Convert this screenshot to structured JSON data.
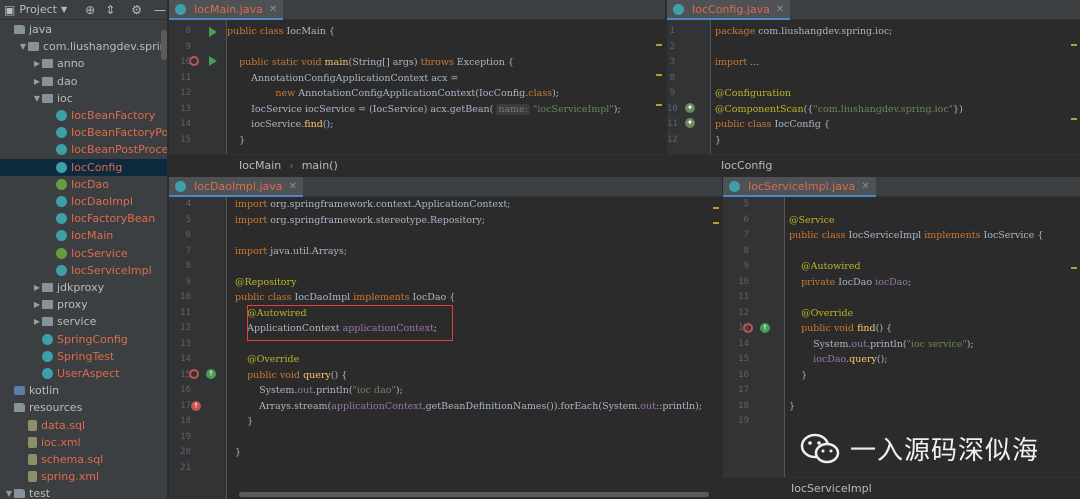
{
  "project_panel": {
    "title": "Project",
    "tree": [
      {
        "label": "java",
        "depth": 0,
        "arrow": "",
        "icon": "folder",
        "color": "normal"
      },
      {
        "label": "com.liushangdev.spring",
        "depth": 1,
        "arrow": "down",
        "icon": "pkg",
        "color": "normal"
      },
      {
        "label": "anno",
        "depth": 2,
        "arrow": "right",
        "icon": "pkg",
        "color": "normal"
      },
      {
        "label": "dao",
        "depth": 2,
        "arrow": "right",
        "icon": "pkg",
        "color": "normal"
      },
      {
        "label": "ioc",
        "depth": 2,
        "arrow": "down",
        "icon": "pkg",
        "color": "normal"
      },
      {
        "label": "IocBeanFactory",
        "depth": 3,
        "arrow": "",
        "icon": "class",
        "color": "red"
      },
      {
        "label": "IocBeanFactoryPostPro",
        "depth": 3,
        "arrow": "",
        "icon": "class",
        "color": "red"
      },
      {
        "label": "IocBeanPostProcessor",
        "depth": 3,
        "arrow": "",
        "icon": "class",
        "color": "red"
      },
      {
        "label": "IocConfig",
        "depth": 3,
        "arrow": "",
        "icon": "class",
        "color": "red",
        "selected": true
      },
      {
        "label": "IocDao",
        "depth": 3,
        "arrow": "",
        "icon": "iface",
        "color": "red"
      },
      {
        "label": "IocDaoImpl",
        "depth": 3,
        "arrow": "",
        "icon": "class",
        "color": "red"
      },
      {
        "label": "IocFactoryBean",
        "depth": 3,
        "arrow": "",
        "icon": "class",
        "color": "red"
      },
      {
        "label": "IocMain",
        "depth": 3,
        "arrow": "",
        "icon": "class",
        "color": "red"
      },
      {
        "label": "IocService",
        "depth": 3,
        "arrow": "",
        "icon": "iface",
        "color": "red"
      },
      {
        "label": "IocServiceImpl",
        "depth": 3,
        "arrow": "",
        "icon": "class",
        "color": "red"
      },
      {
        "label": "jdkproxy",
        "depth": 2,
        "arrow": "right",
        "icon": "pkg",
        "color": "normal"
      },
      {
        "label": "proxy",
        "depth": 2,
        "arrow": "right",
        "icon": "pkg",
        "color": "normal"
      },
      {
        "label": "service",
        "depth": 2,
        "arrow": "right",
        "icon": "pkg",
        "color": "normal"
      },
      {
        "label": "SpringConfig",
        "depth": 2,
        "arrow": "",
        "icon": "class",
        "color": "red"
      },
      {
        "label": "SpringTest",
        "depth": 2,
        "arrow": "",
        "icon": "class",
        "color": "red"
      },
      {
        "label": "UserAspect",
        "depth": 2,
        "arrow": "",
        "icon": "class",
        "color": "red"
      },
      {
        "label": "kotlin",
        "depth": 0,
        "arrow": "",
        "icon": "srcroot",
        "color": "normal"
      },
      {
        "label": "resources",
        "depth": 0,
        "arrow": "",
        "icon": "folder",
        "color": "normal"
      },
      {
        "label": "data.sql",
        "depth": 1,
        "arrow": "",
        "icon": "file",
        "color": "red"
      },
      {
        "label": "ioc.xml",
        "depth": 1,
        "arrow": "",
        "icon": "file",
        "color": "red"
      },
      {
        "label": "schema.sql",
        "depth": 1,
        "arrow": "",
        "icon": "file",
        "color": "red"
      },
      {
        "label": "spring.xml",
        "depth": 1,
        "arrow": "",
        "icon": "file",
        "color": "red"
      },
      {
        "label": "test",
        "depth": 0,
        "arrow": "down",
        "icon": "folder",
        "color": "normal"
      }
    ]
  },
  "panes": {
    "ioc_main": {
      "tab": "IocMain.java",
      "breadcrumb": [
        "IocMain",
        "main()"
      ],
      "line_numbers": [
        "8",
        "9",
        "10",
        "11",
        "12",
        "13",
        "14",
        "15"
      ],
      "lines": [
        "public class IocMain {",
        "",
        "    public static void main(String[] args) throws Exception {",
        "        AnnotationConfigApplicationContext acx =",
        "                new AnnotationConfigApplicationContext(IocConfig.class);",
        "        IocService iocService = (IocService) acx.getBean( name: \"iocServiceImpl\");",
        "        iocService.find();",
        "    }"
      ]
    },
    "ioc_config": {
      "tab": "IocConfig.java",
      "breadcrumb": [
        "IocConfig"
      ],
      "line_numbers": [
        "1",
        "2",
        "3",
        "8",
        "9",
        "10",
        "11",
        "12"
      ],
      "lines": [
        "package com.liushangdev.spring.ioc;",
        "",
        "import ...",
        "",
        "@Configuration",
        "@ComponentScan({\"com.liushangdev.spring.ioc\"})",
        "public class IocConfig {",
        "}"
      ]
    },
    "ioc_dao_impl": {
      "tab": "IocDaoImpl.java",
      "line_numbers": [
        "4",
        "5",
        "6",
        "7",
        "8",
        "9",
        "10",
        "11",
        "12",
        "13",
        "14",
        "15",
        "16",
        "17",
        "18",
        "19",
        "20",
        "21"
      ],
      "lines": [
        "import org.springframework.context.ApplicationContext;",
        "import org.springframework.stereotype.Repository;",
        "",
        "import java.util.Arrays;",
        "",
        "@Repository",
        "public class IocDaoImpl implements IocDao {",
        "    @Autowired",
        "    ApplicationContext applicationContext;",
        "",
        "    @Override",
        "    public void query() {",
        "        System.out.println(\"ioc dao\");",
        "        Arrays.stream(applicationContext.getBeanDefinitionNames()).forEach(System.out::println);",
        "    }",
        "",
        "}",
        ""
      ]
    },
    "ioc_service_impl": {
      "tab": "IocServiceImpl.java",
      "breadcrumb": [
        "IocServiceImpl"
      ],
      "line_numbers": [
        "5",
        "6",
        "7",
        "8",
        "9",
        "10",
        "11",
        "12",
        "13",
        "14",
        "15",
        "16",
        "17",
        "18",
        "19"
      ],
      "lines": [
        "",
        "@Service",
        "public class IocServiceImpl implements IocService {",
        "",
        "    @Autowired",
        "    private IocDao iocDao;",
        "",
        "    @Override",
        "    public void find() {",
        "        System.out.println(\"ioc service\");",
        "        iocDao.query();",
        "    }",
        "",
        "}",
        ""
      ]
    }
  },
  "watermark": {
    "text": "一入源码深似海"
  },
  "colors": {
    "keyword": "#cc7832",
    "annotation": "#bbb529",
    "string": "#6a8759",
    "field": "#9876aa",
    "method": "#ffc66d",
    "modified_file": "#dd6b4b",
    "highlight_box": "#e04040"
  }
}
